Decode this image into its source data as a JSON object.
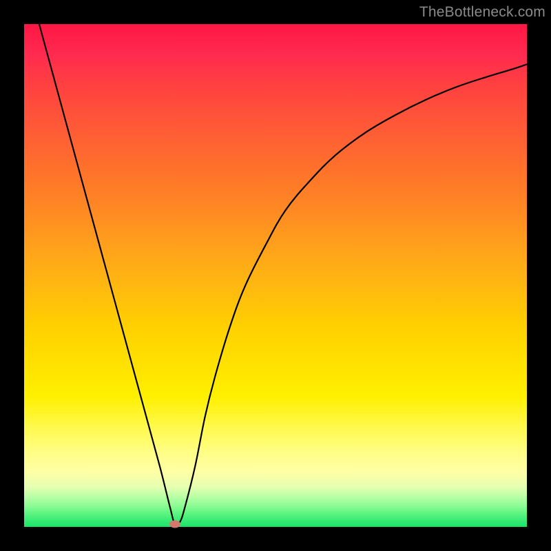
{
  "watermark": "TheBottleneck.com",
  "chart_data": {
    "type": "line",
    "title": "",
    "xlabel": "",
    "ylabel": "",
    "xlim": [
      0,
      100
    ],
    "ylim": [
      0,
      100
    ],
    "series": [
      {
        "name": "curve",
        "x": [
          3,
          6,
          9,
          12,
          15,
          18,
          21,
          24,
          27,
          29,
          30,
          31,
          32,
          34,
          36,
          38,
          41,
          44,
          48,
          52,
          57,
          62,
          68,
          74,
          80,
          86,
          92,
          97,
          100
        ],
        "values": [
          100,
          89,
          78,
          67,
          56,
          45,
          34,
          23,
          12,
          4,
          0.5,
          1,
          4,
          12,
          22,
          30,
          40,
          48,
          56,
          63,
          69,
          74,
          78.5,
          82,
          85,
          87.5,
          89.5,
          91,
          92
        ]
      }
    ],
    "marker": {
      "x": 30,
      "y": 0.5
    },
    "gradient_stops": [
      {
        "pos": 0,
        "color": "#ff1744"
      },
      {
        "pos": 40,
        "color": "#ff8c1a"
      },
      {
        "pos": 70,
        "color": "#ffe000"
      },
      {
        "pos": 90,
        "color": "#ffffa0"
      },
      {
        "pos": 100,
        "color": "#18e46a"
      }
    ]
  }
}
